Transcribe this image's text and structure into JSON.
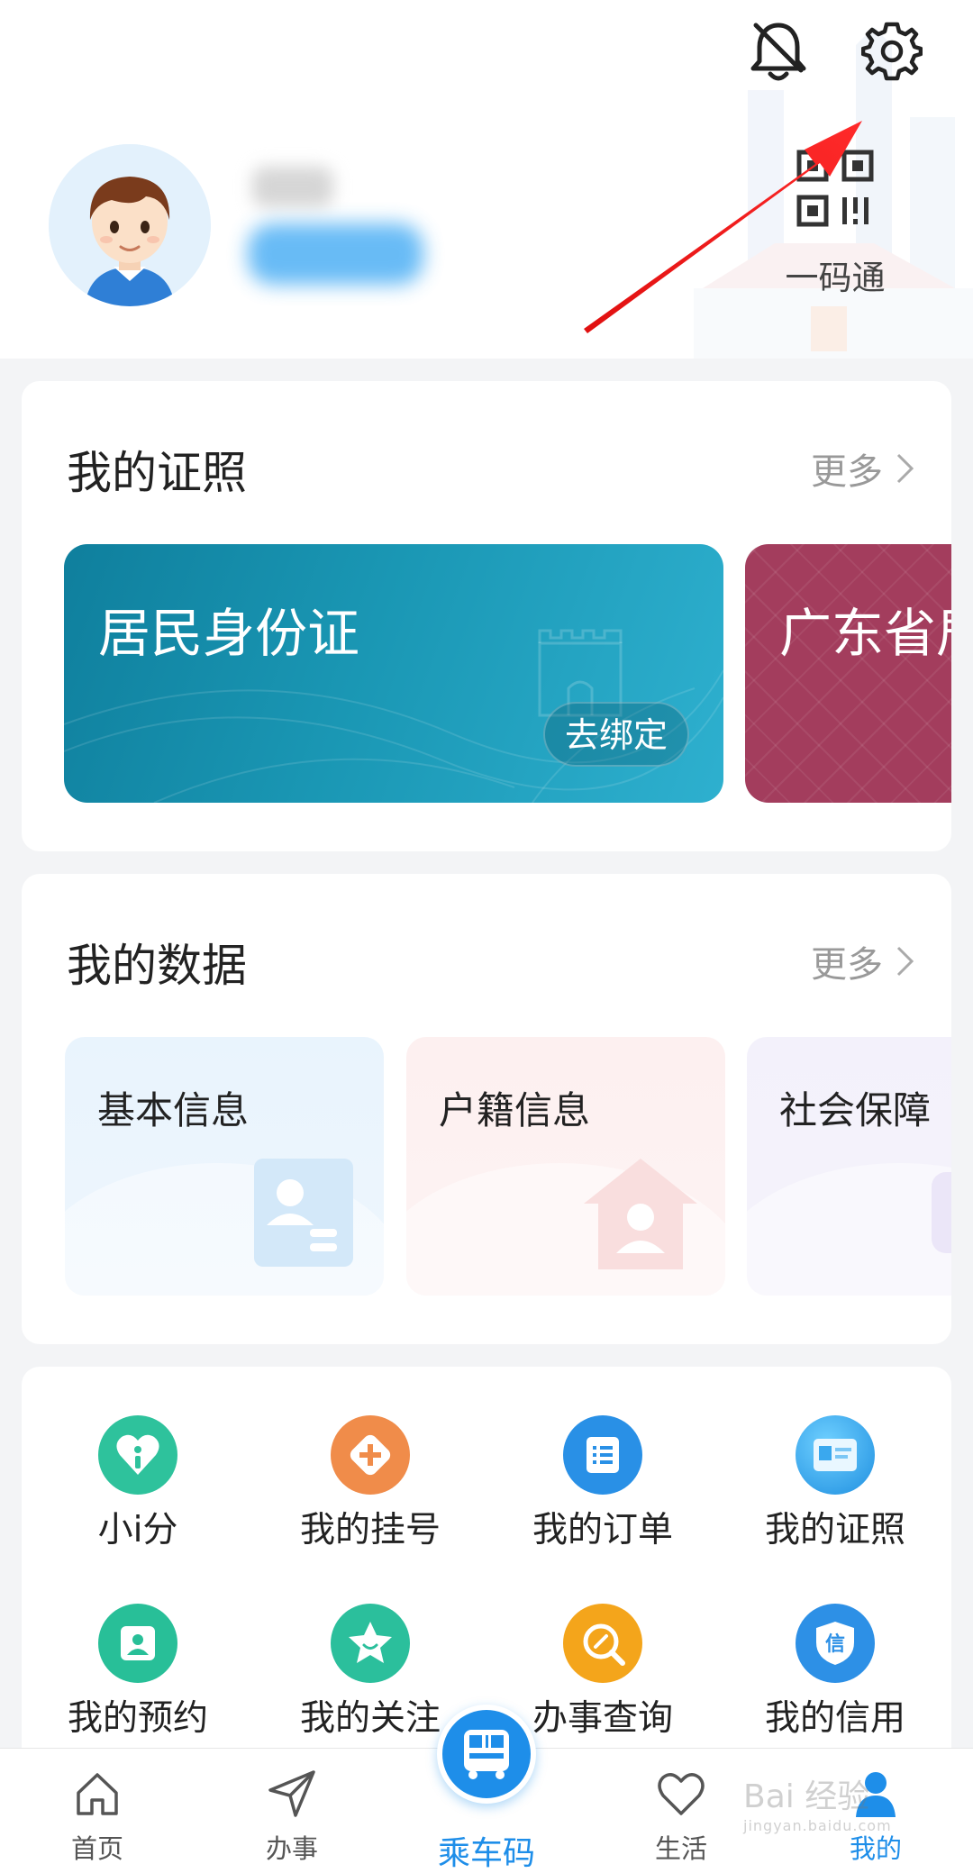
{
  "header": {
    "qr_label": "一码通",
    "icons": {
      "bell": "notification-bell-icon",
      "gear": "settings-gear-icon",
      "qr": "qr-code-icon"
    }
  },
  "licenses": {
    "title": "我的证照",
    "more": "更多",
    "cards": [
      {
        "name": "居民身份证",
        "action": "去绑定",
        "color": "#1a97b4"
      },
      {
        "name": "广东省居",
        "color": "#a33d5d"
      }
    ]
  },
  "my_data": {
    "title": "我的数据",
    "more": "更多",
    "tiles": [
      {
        "label": "基本信息"
      },
      {
        "label": "户籍信息"
      },
      {
        "label": "社会保障"
      }
    ]
  },
  "services": [
    {
      "label": "小i分",
      "icon": "heart-i-icon",
      "color": "#2ec29c"
    },
    {
      "label": "我的挂号",
      "icon": "medical-plus-icon",
      "color": "#f08c4a"
    },
    {
      "label": "我的订单",
      "icon": "order-list-icon",
      "color": "#2990e6"
    },
    {
      "label": "我的证照",
      "icon": "license-card-icon",
      "color": "#32a7ea"
    },
    {
      "label": "我的预约",
      "icon": "appointment-person-icon",
      "color": "#28bf98"
    },
    {
      "label": "我的关注",
      "icon": "star-smile-icon",
      "color": "#2bbf9c"
    },
    {
      "label": "办事查询",
      "icon": "search-pen-icon",
      "color": "#f4a51b"
    },
    {
      "label": "我的信用",
      "icon": "credit-shield-icon",
      "color": "#2d90e6"
    }
  ],
  "tabbar": {
    "tabs": [
      {
        "label": "首页",
        "icon": "home-icon"
      },
      {
        "label": "办事",
        "icon": "send-arrow-icon"
      },
      {
        "label": "乘车码",
        "icon": "bus-qr-icon"
      },
      {
        "label": "生活",
        "icon": "heart-outline-icon"
      },
      {
        "label": "我的",
        "icon": "user-icon",
        "active": true
      }
    ],
    "accent": "#1e8ee9"
  },
  "watermark": {
    "main": "Bai 经验",
    "sub": "jingyan.baidu.com"
  }
}
